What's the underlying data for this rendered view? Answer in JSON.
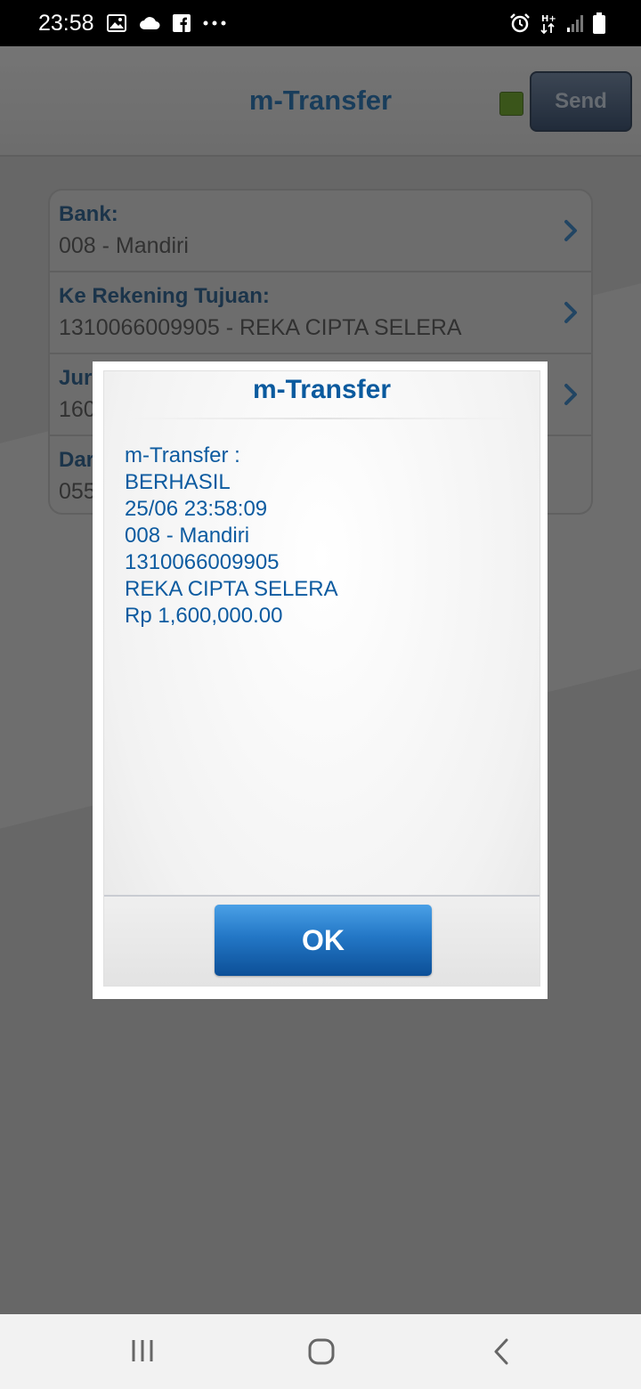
{
  "status_bar": {
    "time": "23:58",
    "left_icons": [
      "image-icon",
      "cloud-icon",
      "facebook-icon",
      "more-dots-icon"
    ],
    "right_icons": [
      "alarm-icon",
      "hplus-data-icon",
      "signal-icon",
      "battery-icon"
    ],
    "hplus_label": "H+"
  },
  "app": {
    "title": "m-Transfer",
    "send_label": "Send",
    "status_led_color": "#4a7a10",
    "form_rows": [
      {
        "label": "Bank:",
        "value": "008 - Mandiri"
      },
      {
        "label": "Ke Rekening Tujuan:",
        "value": "1310066009905 - REKA CIPTA SELERA"
      },
      {
        "label": "Jur",
        "value": "160"
      },
      {
        "label": "Dar",
        "value": "055"
      }
    ]
  },
  "dialog": {
    "title": "m-Transfer",
    "message_lines": [
      "m-Transfer :",
      "BERHASIL",
      "25/06 23:58:09",
      "008 - Mandiri",
      "1310066009905",
      "REKA CIPTA SELERA",
      "Rp 1,600,000.00"
    ],
    "ok_label": "OK"
  },
  "nav_bar": {
    "buttons": [
      "recent-apps-icon",
      "home-icon",
      "back-icon"
    ]
  },
  "colors": {
    "brand_blue": "#0a5a9e",
    "ok_button": "#2377c6"
  }
}
